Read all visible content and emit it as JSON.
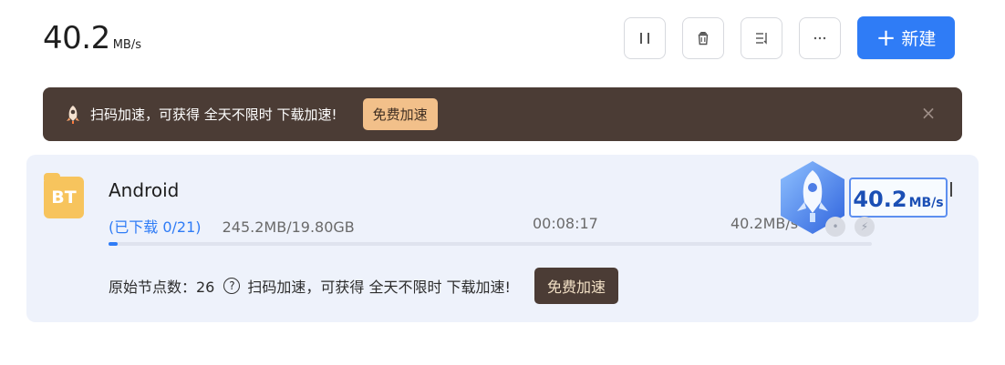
{
  "header": {
    "speed_value": "40.2",
    "speed_unit": "MB/s"
  },
  "toolbar": {
    "pause_icon": "pause-icon",
    "delete_icon": "trash-icon",
    "sort_icon": "sort-list-icon",
    "more_icon": "ellipsis-icon",
    "new_label": "新建"
  },
  "banner": {
    "icon": "rocket-icon",
    "text": "扫码加速，可获得 全天不限时 下载加速!",
    "accel_label": "免费加速",
    "close_icon": "close-icon"
  },
  "download": {
    "icon_text": "BT",
    "name": "Android",
    "downloaded": "(已下载 0/21)",
    "size": "245.2MB/19.80GB",
    "eta": "00:08:17",
    "rate": "40.2MB/s",
    "progress_percent": 1.2,
    "nodes_label": "原始节点数：26",
    "help_icon": "help-circle-icon",
    "promo_text": "扫码加速，可获得 全天不限时 下载加速!",
    "promo_button": "免费加速"
  },
  "floating_speed": {
    "value": "40.2",
    "unit": "MB/s",
    "icon": "rocket-icon"
  },
  "colors": {
    "accent": "#2f7cf6",
    "banner_bg": "#4b3c35",
    "banner_button_bg": "#f2c08a",
    "card_bg": "#eef2fb",
    "bt_icon": "#f7c45d"
  }
}
